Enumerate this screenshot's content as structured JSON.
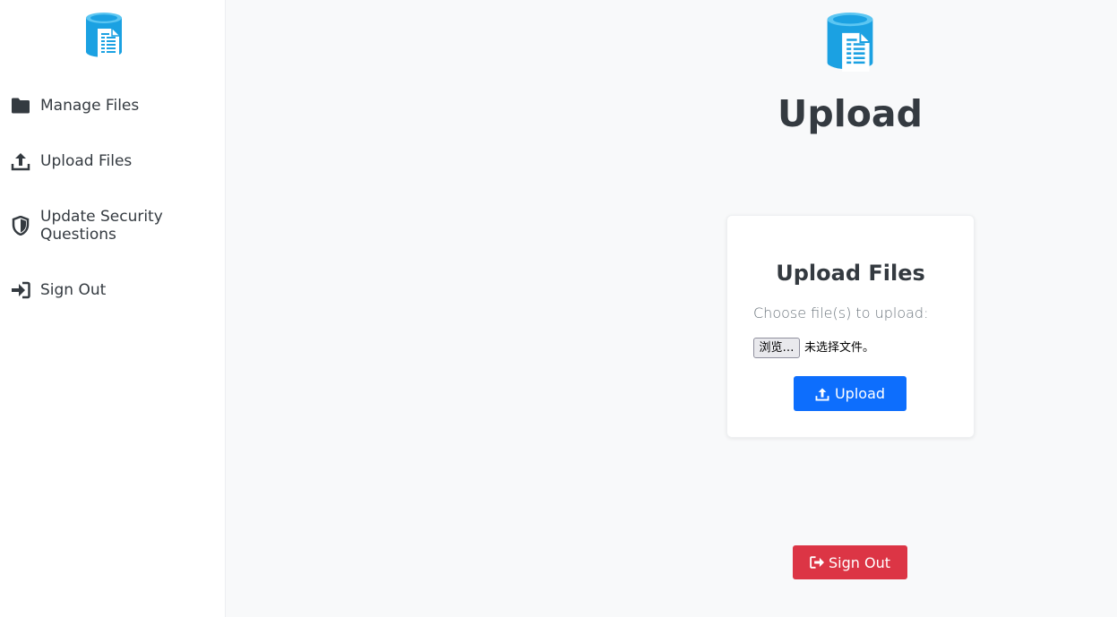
{
  "sidebar": {
    "logo_icon": "file-database-icon",
    "items": [
      {
        "label": "Manage Files",
        "icon": "folder-icon"
      },
      {
        "label": "Upload Files",
        "icon": "upload-icon"
      },
      {
        "label": "Update Security Questions",
        "icon": "shield-icon"
      },
      {
        "label": "Sign Out",
        "icon": "sign-in-icon"
      }
    ]
  },
  "main": {
    "logo_icon": "file-database-icon",
    "title": "Upload",
    "card": {
      "title": "Upload Files",
      "prompt": "Choose file(s) to upload:",
      "file_button_label": "浏览…",
      "file_status": "未选择文件。",
      "upload_button_label": "Upload"
    },
    "signout_button_label": "Sign Out"
  },
  "colors": {
    "primary": "#0d6efd",
    "danger": "#dc3545",
    "logo": "#1ba1e2",
    "sidebar_bg": "#ffffff",
    "page_bg": "#f8f9fa"
  }
}
